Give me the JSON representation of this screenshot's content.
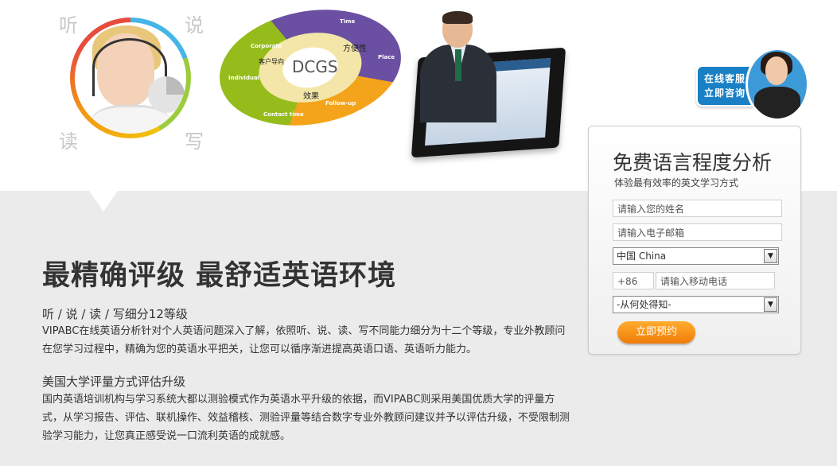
{
  "hero": {
    "circle_chars": [
      "听",
      "说",
      "读",
      "写"
    ],
    "dcgs": {
      "title": "DCGS",
      "labels": [
        "Time",
        "Place",
        "Follow-up",
        "Contact time",
        "Individual",
        "Corporate"
      ],
      "cn_labels": [
        "方便性",
        "客户导向",
        "效果"
      ]
    }
  },
  "service_badge": {
    "line1": "在线客服",
    "line2": "立即咨询"
  },
  "form": {
    "title": "免费语言程度分析",
    "subtitle": "体验最有效率的英文学习方式",
    "name_placeholder": "请输入您的姓名",
    "email_placeholder": "请输入电子邮箱",
    "country_selected": "中国 China",
    "phone_prefix": "+86",
    "phone_placeholder": "请输入移动电话",
    "source_selected": "-从何处得知-",
    "submit_label": "立即预约"
  },
  "content": {
    "headline": "最精确评级  最舒适英语环境",
    "section1_title": "听 / 说 / 读 / 写细分12等级",
    "section1_text": "VIPABC在线英语分析针对个人英语问题深入了解，依照听、说、读、写不同能力细分为十二个等级，专业外教顾问在您学习过程中，精确为您的英语水平把关，让您可以循序渐进提高英语口语、英语听力能力。",
    "section2_title": "美国大学评量方式评估升级",
    "section2_text": "国内英语培训机构与学习系统大都以测验模式作为英语水平升级的依据，而VIPABC则采用美国优质大学的评量方式，从学习报告、评估、联机操作、效益稽核、测验评量等结合数字专业外教顾问建议并予以评估升级，不受限制测验学习能力，让您真正感受说一口流利英语的成就感。"
  },
  "colors": {
    "accent_orange": "#f07b05",
    "badge_blue": "#1980c5",
    "background": "#ebebeb"
  }
}
